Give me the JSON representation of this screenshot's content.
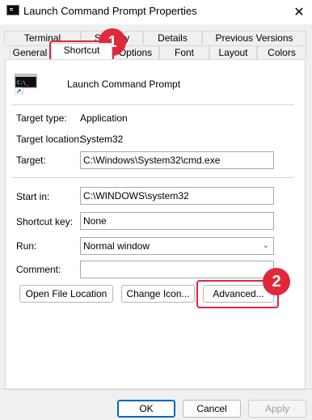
{
  "window": {
    "title": "Launch Command Prompt Properties",
    "close_glyph": "✕"
  },
  "tabs": {
    "row1": [
      "Terminal",
      "Security",
      "Details",
      "Previous Versions"
    ],
    "row2": [
      "General",
      "Shortcut",
      "Options",
      "Font",
      "Layout",
      "Colors"
    ],
    "active": "Shortcut"
  },
  "shortcut": {
    "name": "Launch Command Prompt",
    "target_type_label": "Target type:",
    "target_type_value": "Application",
    "target_location_label": "Target location:",
    "target_location_value": "System32",
    "target_label": "Target:",
    "target_value": "C:\\Windows\\System32\\cmd.exe",
    "start_in_label": "Start in:",
    "start_in_value": "C:\\WINDOWS\\system32",
    "shortcut_key_label": "Shortcut key:",
    "shortcut_key_value": "None",
    "run_label": "Run:",
    "run_value": "Normal window",
    "comment_label": "Comment:",
    "comment_value": ""
  },
  "buttons": {
    "open_file_location": "Open File Location",
    "change_icon": "Change Icon...",
    "advanced": "Advanced...",
    "ok": "OK",
    "cancel": "Cancel",
    "apply": "Apply"
  },
  "annotations": {
    "step1": "1",
    "step2": "2",
    "color": "#e0283a"
  }
}
